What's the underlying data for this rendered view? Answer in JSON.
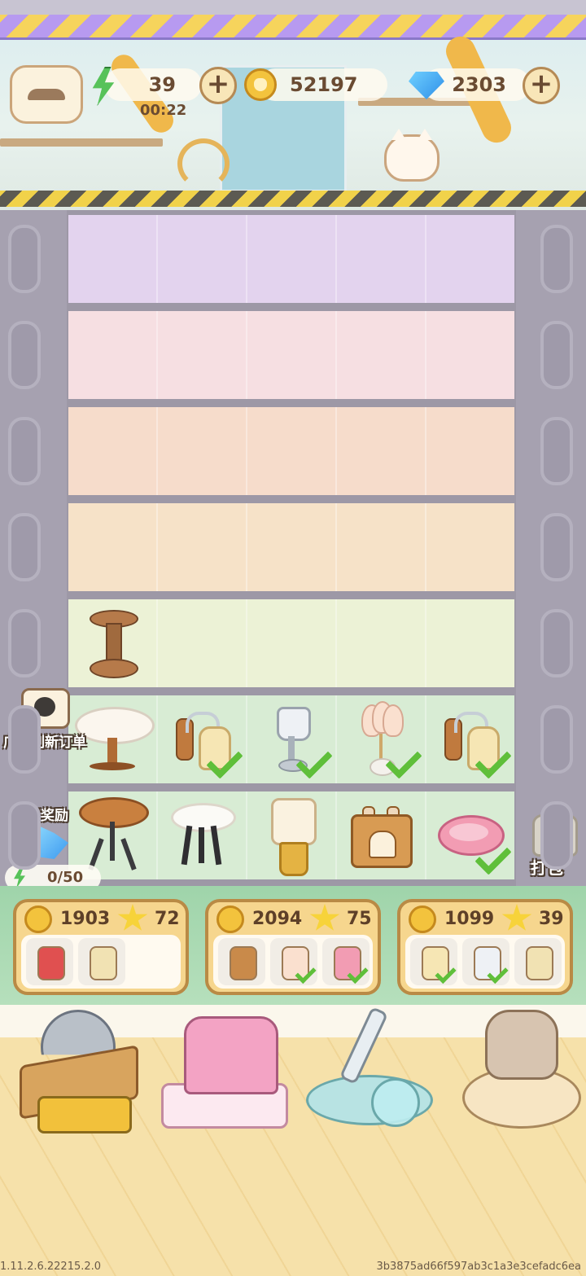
{
  "hud": {
    "energy": "39",
    "energy_timer": "00:22",
    "coins": "52197",
    "gems": "2303"
  },
  "side": {
    "ad_refresh_label": "广告刷新订单",
    "daily_reward_label": "今日奖励",
    "daily_energy": "0/50",
    "pack_label": "打包"
  },
  "grid": {
    "rows": [
      {
        "color": "#e3d3ee",
        "items": [
          "",
          "",
          "",
          "",
          ""
        ]
      },
      {
        "color": "#f6dfe2",
        "items": [
          "",
          "",
          "",
          "",
          ""
        ]
      },
      {
        "color": "#f6dccb",
        "items": [
          "",
          "",
          "",
          "",
          ""
        ]
      },
      {
        "color": "#f6e2c8",
        "items": [
          "",
          "",
          "",
          "",
          ""
        ]
      },
      {
        "color": "#ecf2d6",
        "items": [
          "spool-stool",
          "",
          "",
          "",
          ""
        ]
      },
      {
        "color": "#d8ecd4",
        "items": [
          "round-table",
          "wall-lamp",
          "table-lamp",
          "tulip-lamp",
          "wall-lamp"
        ],
        "checks": [
          false,
          true,
          true,
          true,
          true
        ]
      },
      {
        "color": "#d8ecd4",
        "items": [
          "bar-stool",
          "white-stool",
          "glass-lamp",
          "cat-box",
          "pink-bed"
        ],
        "checks": [
          false,
          false,
          false,
          false,
          true
        ]
      }
    ]
  },
  "orders": [
    {
      "coins": "1903",
      "stars": "72",
      "items": [
        {
          "icon": "red-toilet-icon",
          "color": "#e05050",
          "done": false
        },
        {
          "icon": "drawer-cabinet-icon",
          "color": "#f1e2b3",
          "done": false
        }
      ]
    },
    {
      "coins": "2094",
      "stars": "75",
      "items": [
        {
          "icon": "wooden-cabinet-icon",
          "color": "#c98a4a",
          "done": false
        },
        {
          "icon": "tulip-lamp-icon",
          "color": "#fae0cf",
          "done": true
        },
        {
          "icon": "pink-bed-icon",
          "color": "#f29cb3",
          "done": true
        }
      ]
    },
    {
      "coins": "1099",
      "stars": "39",
      "items": [
        {
          "icon": "wall-lamp-icon",
          "color": "#f6e6b4",
          "done": true
        },
        {
          "icon": "table-lamp-icon",
          "color": "#eef1f5",
          "done": true
        },
        {
          "icon": "drawer-cabinet-icon",
          "color": "#f1e2b3",
          "done": false
        }
      ]
    }
  ],
  "footer": {
    "version": "1.11.2.6.22215.2.0",
    "build_hash": "3b3875ad66f597ab3c1a3e3cefadc6ea"
  }
}
